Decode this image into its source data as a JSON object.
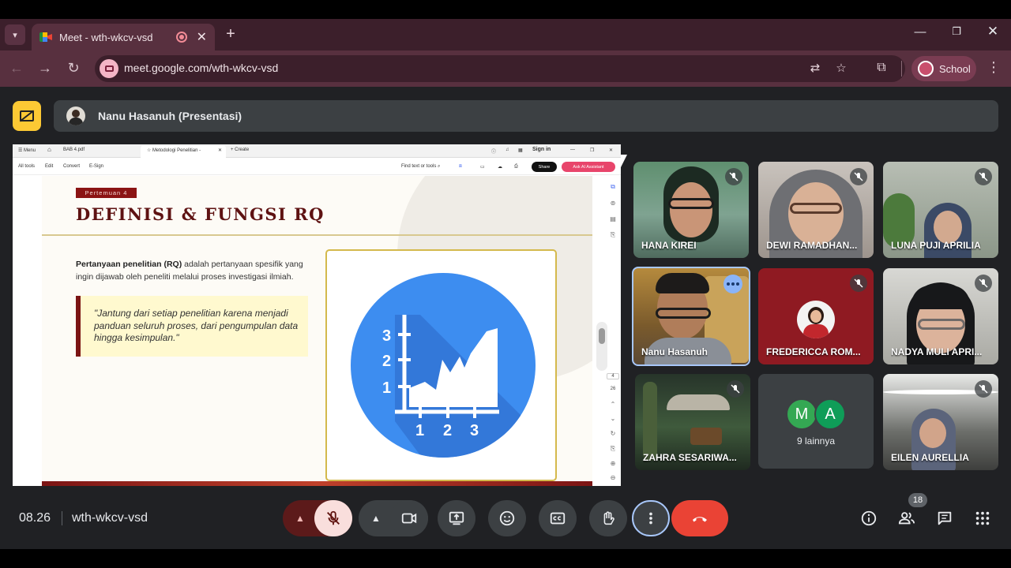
{
  "browser": {
    "tab_title": "Meet - wth-wkcv-vsd",
    "url": "meet.google.com/wth-wkcv-vsd",
    "profile_label": "School",
    "icons": [
      "tab-list-icon",
      "meet-favicon",
      "recording-icon",
      "close-tab-icon",
      "new-tab-icon",
      "minimize-icon",
      "restore-icon",
      "close-window-icon",
      "back-icon",
      "forward-icon",
      "reload-icon",
      "translate-icon",
      "bookmark-star-icon",
      "extensions-icon",
      "kebab-menu-icon"
    ]
  },
  "meet": {
    "presenter_banner": "Nanu Hasanuh (Presentasi)",
    "time": "08.26",
    "meeting_code": "wth-wkcv-vsd",
    "participant_count": "18",
    "others_label": "9 lainnya",
    "others_avatars": [
      "M",
      "A"
    ],
    "participants": [
      {
        "name": "HANA KIREI",
        "muted": true
      },
      {
        "name": "DEWI RAMADHAN...",
        "muted": true
      },
      {
        "name": "LUNA PUJI APRILIA",
        "muted": true
      },
      {
        "name": "Nanu Hasanuh",
        "muted": false
      },
      {
        "name": "FREDERICCA ROM...",
        "muted": true
      },
      {
        "name": "NADYA MULI APRI...",
        "muted": true
      },
      {
        "name": "ZAHRA SESARIWA...",
        "muted": true
      },
      {
        "name": "EILEN AURELLIA",
        "muted": true
      }
    ]
  },
  "shared_screen": {
    "tabs": {
      "menu": "Menu",
      "file": "BAB 4.pdf",
      "active_tab": "Metodologi Penelitian -",
      "create": "Create",
      "sign_in": "Sign in"
    },
    "menubar": {
      "all_tools": "All tools",
      "edit": "Edit",
      "convert": "Convert",
      "esign": "E-Sign",
      "find": "Find text or tools",
      "share": "Share",
      "ai": "Ask AI Assistant"
    },
    "page_current": "4",
    "page_total": "26",
    "slide": {
      "badge": "Pertemuan 4",
      "title": "DEFINISI & FUNGSI RQ",
      "definition_bold": "Pertanyaan penelitian (RQ)",
      "definition_rest": " adalah pertanyaan spesifik yang ingin dijawab oleh peneliti melalui proses investigasi ilmiah.",
      "quote": "\"Jantung dari setiap penelitian karena menjadi panduan seluruh proses, dari pengumpulan data hingga kesimpulan.\"",
      "icon_y_ticks": [
        "3",
        "2",
        "1"
      ],
      "icon_x_ticks": [
        "1",
        "2",
        "3"
      ]
    }
  },
  "colors": {
    "meet_bg": "#202124",
    "tab_bar": "#3c1f2b",
    "toolbar": "#58303f",
    "present_icon": "#fcc934",
    "slide_accent": "#7b1414",
    "hangup": "#ea4335",
    "mic_off_bg": "#f9dedc",
    "chart_icon_blue": "#3d8df0"
  }
}
